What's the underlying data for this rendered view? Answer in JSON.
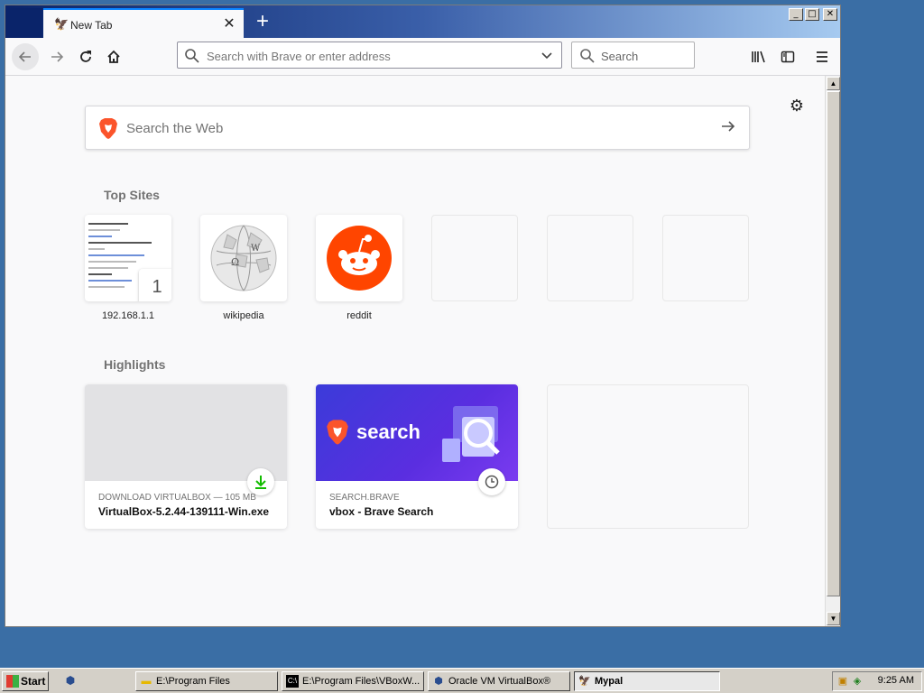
{
  "browser": {
    "tab": {
      "title": "New Tab",
      "close": "✕"
    },
    "newtab_label": "+",
    "window_controls": [
      "_",
      "□",
      "✕"
    ],
    "urlbar": {
      "placeholder": "Search with Brave or enter address"
    },
    "searchbar": {
      "placeholder": "Search"
    }
  },
  "newtab": {
    "websearch_placeholder": "Search the Web",
    "top_sites_title": "Top Sites",
    "top_sites": [
      {
        "label": "192.168.1.1",
        "badge": "1"
      },
      {
        "label": "wikipedia"
      },
      {
        "label": "reddit"
      },
      {
        "label": ""
      },
      {
        "label": ""
      },
      {
        "label": ""
      }
    ],
    "highlights_title": "Highlights",
    "highlights": [
      {
        "meta": "DOWNLOAD VIRTUALBOX — 105 MB",
        "title": "VirtualBox-5.2.44-139111-Win.exe"
      },
      {
        "meta": "SEARCH.BRAVE",
        "title": "vbox - Brave Search",
        "thumb_text": "search"
      }
    ]
  },
  "taskbar": {
    "start_label": "Start",
    "tasks": [
      {
        "label": "E:\\Program Files"
      },
      {
        "label": "E:\\Program Files\\VBoxW..."
      },
      {
        "label": "Oracle VM VirtualBox®"
      },
      {
        "label": "Mypal"
      }
    ],
    "clock": "9:25 AM"
  },
  "colors": {
    "brave_orange": "#fb542b",
    "reddit_orange": "#ff4500",
    "highlight_purple": "#3b3bd9",
    "download_green": "#12bc00",
    "desktop": "#3a6ea5"
  }
}
